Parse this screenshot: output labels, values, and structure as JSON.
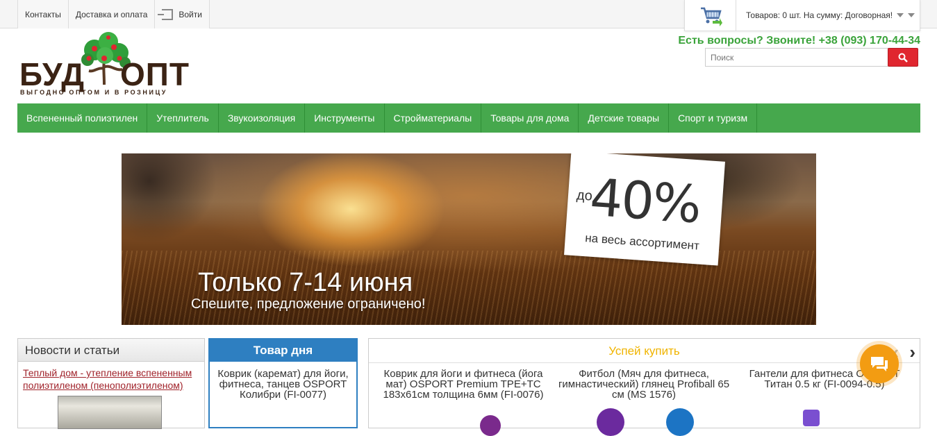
{
  "topbar": {
    "links": [
      {
        "label": "Контакты"
      },
      {
        "label": "Доставка и оплата"
      },
      {
        "label": "Войти"
      }
    ],
    "cart_text": "Товаров: 0 шт. На сумму: Договорная!"
  },
  "logo": {
    "left": "БУД",
    "right": "ОПТ",
    "tagline": "ВЫГОДНО ОПТОМ И В РОЗНИЦУ"
  },
  "header": {
    "phone": "Есть вопросы? Звоните! +38 (093) 170-44-34",
    "search_placeholder": "Поиск"
  },
  "nav": {
    "items": [
      {
        "label": "Вспененный полиэтилен"
      },
      {
        "label": "Утеплитель"
      },
      {
        "label": "Звукоизоляция"
      },
      {
        "label": "Инструменты"
      },
      {
        "label": "Стройматериалы"
      },
      {
        "label": "Товары для дома"
      },
      {
        "label": "Детские товары"
      },
      {
        "label": "Спорт и туризм"
      }
    ]
  },
  "banner": {
    "discount": "40%",
    "do": "до",
    "subtitle": "на весь ассортимент",
    "headline": "Только 7-14 июня",
    "tagline": "Спешите, предложение ограничено!"
  },
  "news": {
    "title": "Новости и статьи",
    "link": "Теплый дом - утепление вспененным полиэтиленом (пенополиэтиленом)"
  },
  "deal": {
    "title": "Товар дня",
    "product": "Коврик (каремат) для йоги, фитнеса, танцев OSPORT Колибри (FI-0077)"
  },
  "hurry": {
    "title": "Успей купить",
    "products": [
      {
        "name": "Коврик для йоги и фитнеса (йога мат) OSPORT Premium TPE+TC 183х61см толщина 6мм (FI-0076)"
      },
      {
        "name": "Фитбол (Мяч для фитнеса, гимнастический) глянец Profiball 65 см (MS 1576)"
      },
      {
        "name": "Гантели для фитнеса OSPORT Титан 0.5 кг (FI-0094-0.5)"
      }
    ]
  }
}
